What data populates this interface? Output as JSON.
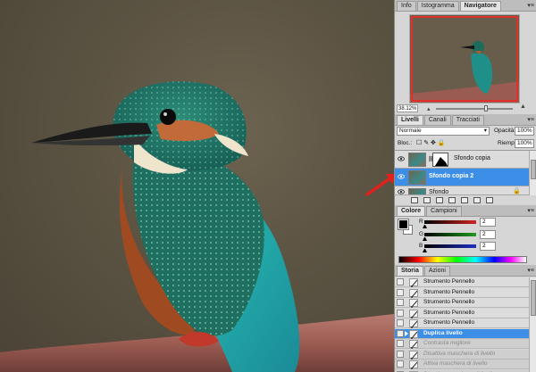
{
  "navigator": {
    "tabs": [
      "Info",
      "Istogramma",
      "Navigatore"
    ],
    "active_tab": 2,
    "zoom": "38.12%",
    "viewport_color": "#e0302a"
  },
  "layers": {
    "tabs": [
      "Livelli",
      "Canali",
      "Tracciati"
    ],
    "active_tab": 0,
    "blend_mode": "Normale",
    "opacity_label": "Opacità:",
    "opacity_value": "100%",
    "lock_label": "Bloc.:",
    "fill_label": "Riemp.:",
    "fill_value": "100%",
    "items": [
      {
        "name": "Sfondo copia",
        "visible": true,
        "selected": false,
        "has_mask": true
      },
      {
        "name": "Sfondo copia 2",
        "visible": true,
        "selected": true,
        "has_mask": false
      },
      {
        "name": "Sfondo",
        "visible": true,
        "selected": false,
        "has_mask": false
      }
    ],
    "selected_color": "#3d8ee6"
  },
  "color": {
    "tabs": [
      "Colore",
      "Campioni"
    ],
    "active_tab": 0,
    "channels": [
      {
        "label": "R",
        "value": "2",
        "color": "#d12222"
      },
      {
        "label": "G",
        "value": "2",
        "color": "#1f9a1f"
      },
      {
        "label": "B",
        "value": "2",
        "color": "#1f2fc4"
      }
    ]
  },
  "history": {
    "tabs": [
      "Storia",
      "Azioni"
    ],
    "active_tab": 0,
    "items": [
      {
        "label": "Strumento Pennello",
        "state": "done"
      },
      {
        "label": "Strumento Pennello",
        "state": "done"
      },
      {
        "label": "Strumento Pennello",
        "state": "done"
      },
      {
        "label": "Strumento Pennello",
        "state": "done"
      },
      {
        "label": "Strumento Pennello",
        "state": "done"
      },
      {
        "label": "Duplica livello",
        "state": "current"
      },
      {
        "label": "Contrasta migliore",
        "state": "undone"
      },
      {
        "label": "Disattiva maschera di livello",
        "state": "undone"
      },
      {
        "label": "Attiva maschera di livello",
        "state": "undone"
      },
      {
        "label": "Disattiva maschera di livello",
        "state": "undone"
      }
    ]
  },
  "annotation": {
    "arrow_color": "#e5201c"
  }
}
